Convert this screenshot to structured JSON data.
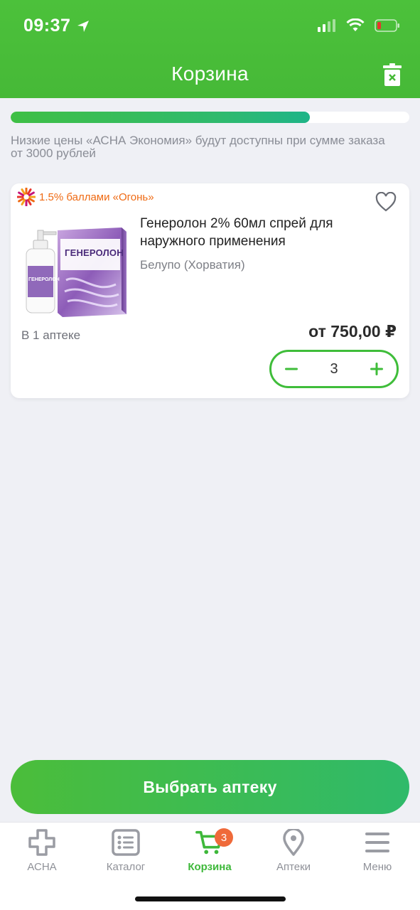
{
  "status_bar": {
    "time": "09:37"
  },
  "header": {
    "title": "Корзина"
  },
  "promo": {
    "progress_fraction": 0.75,
    "note": "Низкие цены «АСНА Экономия» будут доступны при сумме заказа от 3000 рублей"
  },
  "cart_item": {
    "bonus_label": "1.5% баллами «Огонь»",
    "title": "Генеролон 2% 60мл спрей для наружного применения",
    "manufacturer": "Белупо (Хорватия)",
    "availability": "В 1 аптеке",
    "price": "от 750,00 ₽",
    "quantity": "3",
    "image_brand": "ГЕНЕРОЛОН"
  },
  "actions": {
    "choose_pharmacy": "Выбрать аптеку"
  },
  "tabbar": {
    "tabs": [
      {
        "label": "АСНА",
        "icon": "cross-icon"
      },
      {
        "label": "Каталог",
        "icon": "list-icon"
      },
      {
        "label": "Корзина",
        "icon": "cart-icon",
        "active": true,
        "badge": "3"
      },
      {
        "label": "Аптеки",
        "icon": "location-pin-icon"
      },
      {
        "label": "Меню",
        "icon": "menu-icon"
      }
    ]
  },
  "colors": {
    "brand_green": "#46b937",
    "accent_orange": "#ef6a13",
    "badge": "#ef6a3a"
  }
}
